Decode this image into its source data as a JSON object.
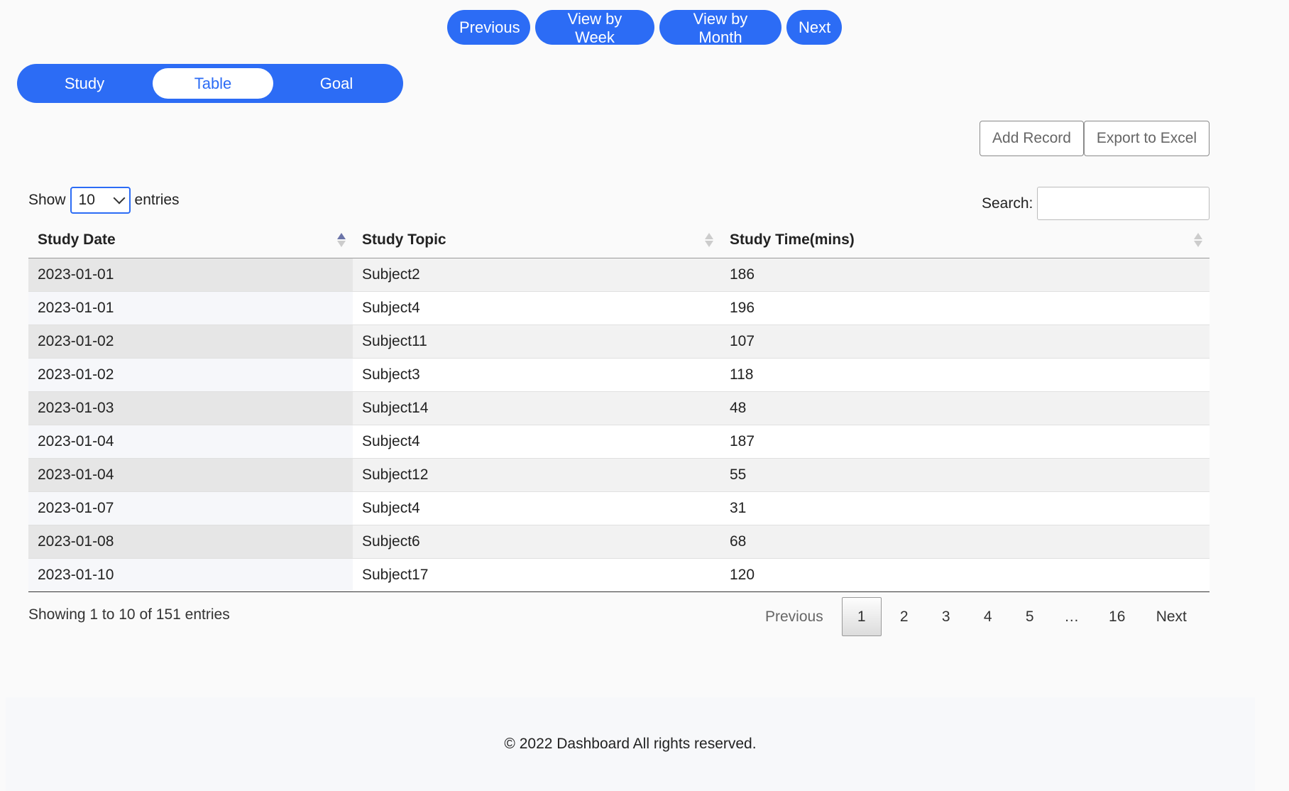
{
  "nav": {
    "previous": "Previous",
    "view_week": "View by Week",
    "view_month": "View by Month",
    "next": "Next"
  },
  "tabs": [
    {
      "label": "Study",
      "active": false
    },
    {
      "label": "Table",
      "active": true
    },
    {
      "label": "Goal",
      "active": false
    }
  ],
  "actions": {
    "add_record": "Add Record",
    "export_excel": "Export to Excel"
  },
  "length": {
    "prefix": "Show",
    "value": "10",
    "suffix": "entries"
  },
  "search": {
    "label": "Search:",
    "value": ""
  },
  "table": {
    "columns": [
      "Study Date",
      "Study Topic",
      "Study Time(mins)"
    ],
    "sorted_column": "Study Date",
    "sort_direction": "ascending",
    "rows": [
      [
        "2023-01-01",
        "Subject2",
        "186"
      ],
      [
        "2023-01-01",
        "Subject4",
        "196"
      ],
      [
        "2023-01-02",
        "Subject11",
        "107"
      ],
      [
        "2023-01-02",
        "Subject3",
        "118"
      ],
      [
        "2023-01-03",
        "Subject14",
        "48"
      ],
      [
        "2023-01-04",
        "Subject4",
        "187"
      ],
      [
        "2023-01-04",
        "Subject12",
        "55"
      ],
      [
        "2023-01-07",
        "Subject4",
        "31"
      ],
      [
        "2023-01-08",
        "Subject6",
        "68"
      ],
      [
        "2023-01-10",
        "Subject17",
        "120"
      ]
    ]
  },
  "info": "Showing 1 to 10 of 151 entries",
  "pagination": {
    "previous": "Previous",
    "current": "1",
    "pages": [
      "2",
      "3",
      "4",
      "5"
    ],
    "ellipsis": "…",
    "last": "16",
    "next": "Next"
  },
  "footer": "© 2022 Dashboard All rights reserved.",
  "colors": {
    "accent": "#2c6cf5",
    "background": "#fafafa"
  }
}
